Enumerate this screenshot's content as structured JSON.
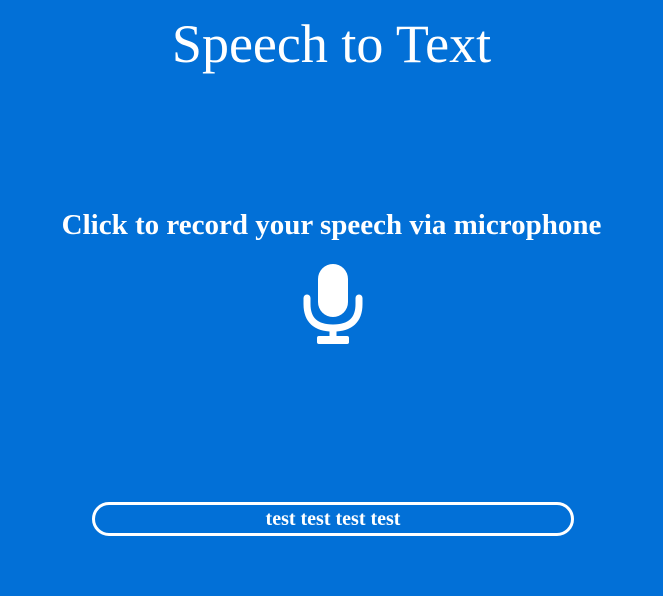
{
  "header": {
    "title": "Speech to Text"
  },
  "main": {
    "instruction": "Click to record your speech via microphone",
    "mic_button": {
      "icon": "microphone-icon"
    },
    "transcript": "test test test test"
  },
  "colors": {
    "background": "#0270d7",
    "foreground": "#ffffff"
  }
}
